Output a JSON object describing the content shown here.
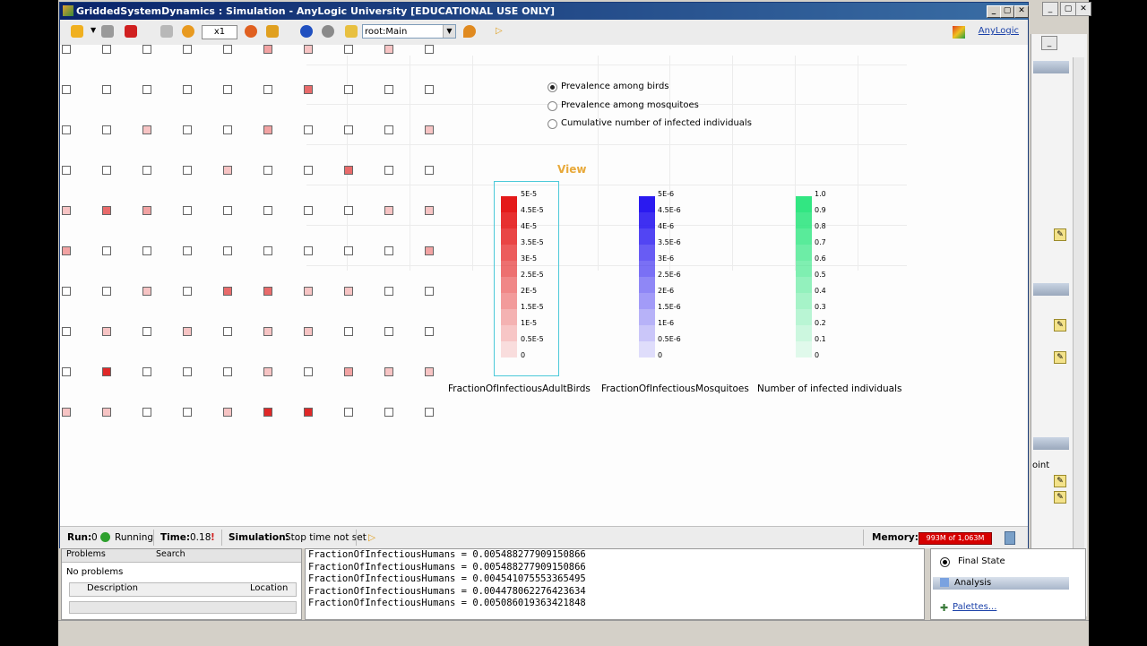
{
  "window": {
    "title": "GriddedSystemDynamics : Simulation - AnyLogic University  [EDUCATIONAL USE ONLY]"
  },
  "toolbar": {
    "speed": "x1",
    "agent_select": "root:Main",
    "brand": "AnyLogic"
  },
  "radio_options": [
    {
      "label": "Prevalence among birds",
      "selected": true
    },
    {
      "label": "Prevalence among mosquitoes",
      "selected": false
    },
    {
      "label": "Cumulative number of infected individuals",
      "selected": false
    }
  ],
  "view_label": "View",
  "legends": [
    {
      "title": "FractionOfInfectiousAdultBirds",
      "color": "#e41a1a",
      "ticks": [
        "5E-5",
        "4.5E-5",
        "4E-5",
        "3.5E-5",
        "3E-5",
        "2.5E-5",
        "2E-5",
        "1.5E-5",
        "1E-5",
        "0.5E-5",
        "0"
      ]
    },
    {
      "title": "FractionOfInfectiousMosquitoes",
      "color": "#2a1af0",
      "ticks": [
        "5E-6",
        "4.5E-6",
        "4E-6",
        "3.5E-6",
        "3E-6",
        "2.5E-6",
        "2E-6",
        "1.5E-6",
        "1E-6",
        "0.5E-6",
        "0"
      ]
    },
    {
      "title": "Number of infected individuals",
      "color": "#32e682",
      "ticks": [
        "1.0",
        "0.9",
        "0.8",
        "0.7",
        "0.6",
        "0.5",
        "0.4",
        "0.3",
        "0.2",
        "0.1",
        "0"
      ]
    }
  ],
  "grid_intensity": [
    [
      0,
      0,
      0,
      0,
      0,
      2,
      1,
      0,
      1,
      0
    ],
    [
      0,
      0,
      0,
      0,
      0,
      0,
      3,
      0,
      0,
      0
    ],
    [
      0,
      0,
      1,
      0,
      0,
      2,
      0,
      0,
      0,
      1
    ],
    [
      0,
      0,
      0,
      0,
      1,
      0,
      0,
      3,
      0,
      0
    ],
    [
      1,
      3,
      2,
      0,
      0,
      0,
      0,
      0,
      1,
      1
    ],
    [
      2,
      0,
      0,
      0,
      0,
      0,
      0,
      0,
      0,
      2
    ],
    [
      0,
      0,
      1,
      0,
      3,
      3,
      1,
      1,
      0,
      0
    ],
    [
      0,
      1,
      0,
      1,
      0,
      1,
      1,
      0,
      0,
      0
    ],
    [
      0,
      4,
      0,
      0,
      0,
      1,
      0,
      2,
      1,
      1
    ],
    [
      1,
      1,
      0,
      0,
      1,
      4,
      4,
      0,
      0,
      0
    ]
  ],
  "status": {
    "run_label": "Run:",
    "run_value": "0",
    "run_state": "Running",
    "time_label": "Time:",
    "time_value": "0.18",
    "sim_label": "Simulation:",
    "sim_value": "Stop time not set",
    "memory_label": "Memory:",
    "memory_value": "993M of 1,063M"
  },
  "problems": {
    "tab_problems": "Problems",
    "tab_search": "Search",
    "no_problems": "No problems",
    "col_description": "Description",
    "col_location": "Location"
  },
  "console_lines": [
    "FractionOfInfectiousHumans = 0.005488277909150866",
    "FractionOfInfectiousHumans = 0.005488277909150866",
    "FractionOfInfectiousHumans = 0.004541075553365495",
    "FractionOfInfectiousHumans = 0.004478062276423634",
    "FractionOfInfectiousHumans = 0.005086019363421848"
  ],
  "side_panel": {
    "point_label": "oint",
    "final_state": "Final State",
    "analysis": "Analysis",
    "palettes": "Palettes..."
  }
}
